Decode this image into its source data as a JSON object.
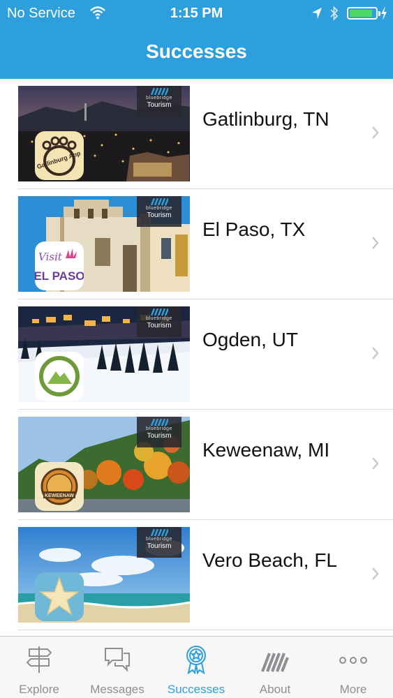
{
  "status_bar": {
    "carrier": "No Service",
    "time": "1:15 PM",
    "battery_level": 0.9
  },
  "nav": {
    "title": "Successes"
  },
  "brand_badge": {
    "top": "bluebridge",
    "bottom": "Tourism"
  },
  "items": [
    {
      "label": "Gatlinburg, TN",
      "app_icon": "bear-paw-icon",
      "app_text": "Gatlinburg App"
    },
    {
      "label": "El Paso, TX",
      "app_icon": "visit-el-paso-icon",
      "app_text_1": "Visit",
      "app_text_2": "EL PASO"
    },
    {
      "label": "Ogden, UT",
      "app_icon": "mountain-circle-icon"
    },
    {
      "label": "Keweenaw, MI",
      "app_icon": "keweenaw-badge-icon",
      "app_text": "KEWEENAW"
    },
    {
      "label": "Vero Beach, FL",
      "app_icon": "starfish-icon"
    }
  ],
  "tabs": [
    {
      "label": "Explore",
      "icon": "signpost-icon",
      "active": false
    },
    {
      "label": "Messages",
      "icon": "chat-bubbles-icon",
      "active": false
    },
    {
      "label": "Successes",
      "icon": "award-ribbon-icon",
      "active": true
    },
    {
      "label": "About",
      "icon": "bluebridge-logo-icon",
      "active": false
    },
    {
      "label": "More",
      "icon": "more-dots-icon",
      "active": false
    }
  ],
  "colors": {
    "header_blue": "#2e9fdd",
    "tab_inactive": "#8e8e93",
    "tab_active": "#2e9fdd"
  }
}
